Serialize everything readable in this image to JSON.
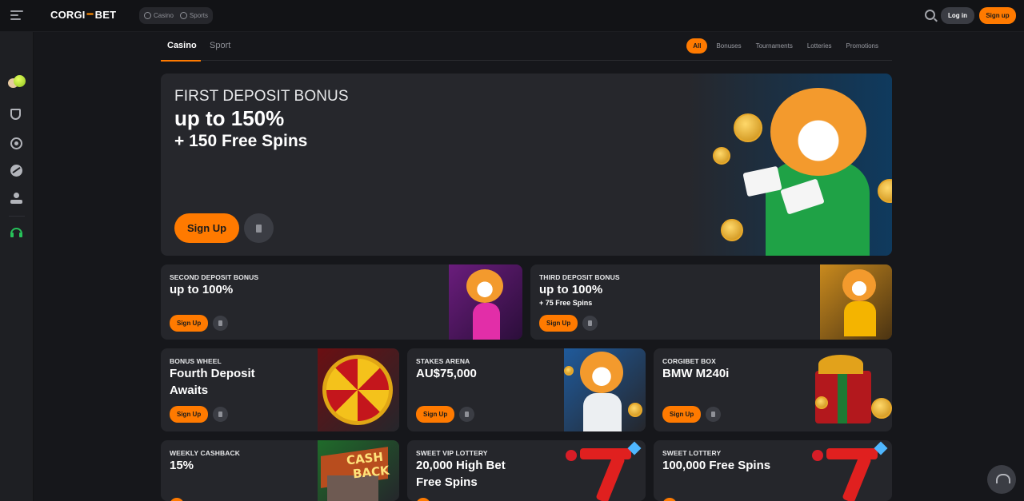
{
  "header": {
    "logo_left": "CORGI",
    "logo_right": "BET",
    "mode_casino": "Casino",
    "mode_sports": "Sports",
    "login_label": "Log in",
    "signup_label": "Sign up"
  },
  "tabs": {
    "casino": "Casino",
    "sport": "Sport"
  },
  "filters": [
    "All",
    "Bonuses",
    "Tournaments",
    "Lotteries",
    "Promotions"
  ],
  "hero": {
    "kicker": "FIRST DEPOSIT BONUS",
    "title": "up to 150%",
    "subtitle": "+ 150 Free Spins",
    "button": "Sign Up"
  },
  "cards": [
    {
      "kicker": "SECOND DEPOSIT BONUS",
      "title": "up to 100%",
      "subtitle": "",
      "button": "Sign Up"
    },
    {
      "kicker": "THIRD DEPOSIT BONUS",
      "title": "up to 100%",
      "subtitle": "+ 75 Free Spins",
      "button": "Sign Up"
    },
    {
      "kicker": "BONUS WHEEL",
      "title_line1": "Fourth Deposit",
      "title_line2": "Awaits",
      "button": "Sign Up"
    },
    {
      "kicker": "STAKES ARENA",
      "title": "AU$75,000",
      "button": "Sign Up"
    },
    {
      "kicker": "CORGIBET BOX",
      "title": "BMW M240i",
      "button": "Sign Up"
    },
    {
      "kicker": "WEEKLY CASHBACK",
      "title": "15%",
      "art_text_1": "CASH",
      "art_text_2": "BACK"
    },
    {
      "kicker": "SWEET VIP LOTTERY",
      "title_line1": "20,000 High Bet",
      "title_line2": "Free Spins"
    },
    {
      "kicker": "SWEET LOTTERY",
      "title": "100,000 Free Spins"
    }
  ],
  "colors": {
    "accent": "#ff7a00",
    "background": "#16171b",
    "card": "#25262b",
    "support_green": "#27c25a"
  },
  "icons": [
    "menu-icon",
    "bone-icon",
    "casino-chip-icon",
    "sports-ball-icon",
    "search-icon",
    "tennis-ball-icon",
    "shield-icon",
    "chip-icon",
    "basketball-icon",
    "joystick-icon",
    "headset-icon",
    "info-icon"
  ]
}
